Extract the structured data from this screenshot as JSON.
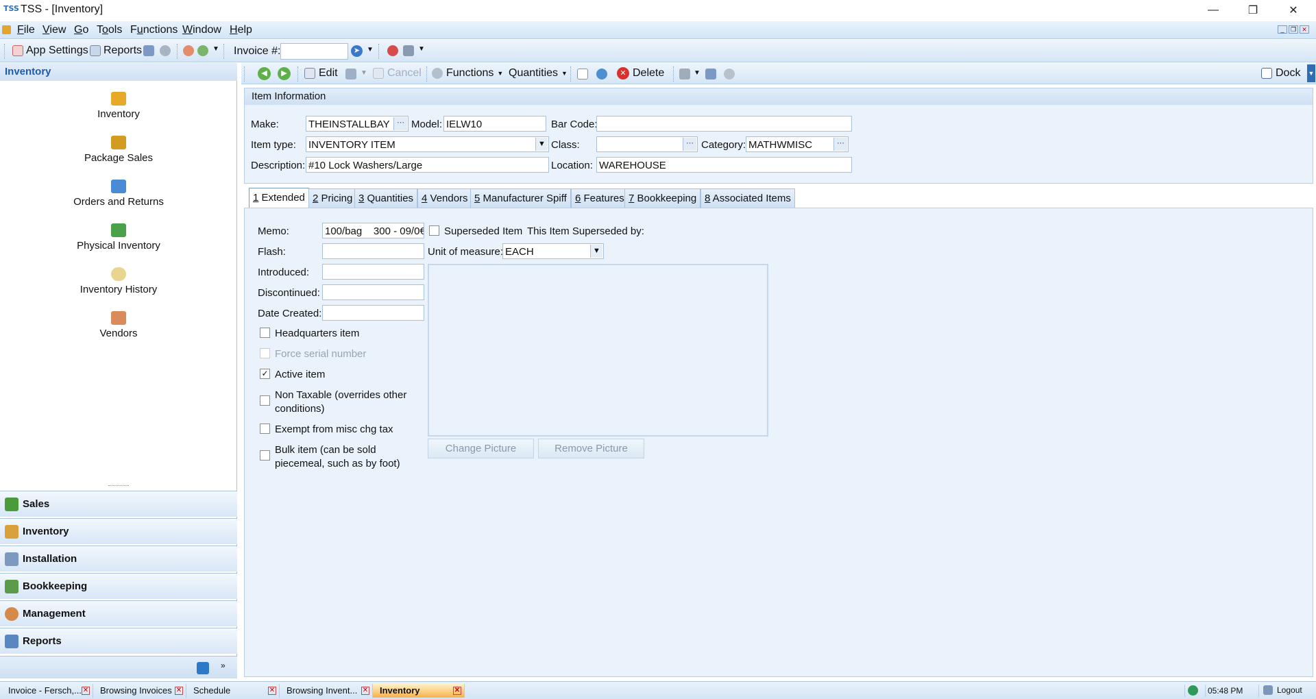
{
  "window": {
    "app_icon_text": "TSS",
    "title": "TSS - [Inventory]"
  },
  "menu": [
    {
      "pre": "",
      "u": "F",
      "post": "ile"
    },
    {
      "pre": "",
      "u": "V",
      "post": "iew"
    },
    {
      "pre": "",
      "u": "G",
      "post": "o"
    },
    {
      "pre": "T",
      "u": "o",
      "post": "ols"
    },
    {
      "pre": "F",
      "u": "u",
      "post": "nctions"
    },
    {
      "pre": "",
      "u": "W",
      "post": "indow"
    },
    {
      "pre": "",
      "u": "H",
      "post": "elp"
    }
  ],
  "toolbar1": {
    "app_settings": "App Settings",
    "reports": "Reports",
    "invoice_label": "Invoice #:",
    "invoice_value": ""
  },
  "leftpanel": {
    "header": "Inventory",
    "items": [
      "Inventory",
      "Package Sales",
      "Orders and Returns",
      "Physical Inventory",
      "Inventory History",
      "Vendors"
    ],
    "sections": [
      "Sales",
      "Inventory",
      "Installation",
      "Bookkeeping",
      "Management",
      "Reports"
    ]
  },
  "toolbar2": {
    "edit": "Edit",
    "cancel": "Cancel",
    "functions": "Functions",
    "quantities": "Quantities",
    "delete": "Delete",
    "dock": "Dock"
  },
  "iteminfo": {
    "header": "Item Information",
    "make_label": "Make:",
    "make": "THEINSTALLBAY",
    "model_label": "Model:",
    "model": "IELW10",
    "barcode_label": "Bar Code:",
    "barcode": "",
    "itemtype_label": "Item type:",
    "itemtype": "INVENTORY ITEM",
    "class_label": "Class:",
    "class": "",
    "category_label": "Category:",
    "category": "MATHWMISC",
    "description_label": "Description:",
    "description": "#10 Lock Washers/Large",
    "location_label": "Location:",
    "location": "WAREHOUSE"
  },
  "tabs": [
    {
      "num": "1",
      "label": " Extended"
    },
    {
      "num": "2",
      "label": " Pricing"
    },
    {
      "num": "3",
      "label": " Quantities"
    },
    {
      "num": "4",
      "label": " Vendors"
    },
    {
      "num": "5",
      "label": " Manufacturer Spiff"
    },
    {
      "num": "6",
      "label": " Features"
    },
    {
      "num": "7",
      "label": " Bookkeeping"
    },
    {
      "num": "8",
      "label": " Associated Items"
    }
  ],
  "extended": {
    "memo_label": "Memo:",
    "memo": "100/bag    300 - 09/0€",
    "flash_label": "Flash:",
    "flash": "",
    "introduced_label": "Introduced:",
    "introduced": "",
    "discontinued_label": "Discontinued:",
    "discontinued": "",
    "datecreated_label": "Date Created:",
    "datecreated": "",
    "superseded_label": "Superseded Item",
    "superseded_by_label": "This Item Superseded by:",
    "uom_label": "Unit of measure:",
    "uom": "EACH",
    "hq": "Headquarters item",
    "force_serial": "Force serial number",
    "active": "Active item",
    "nontax1": "Non Taxable (overrides other",
    "nontax2": "conditions)",
    "exempt": "Exempt from misc chg tax",
    "bulk1": "Bulk item (can be sold",
    "bulk2": "piecemeal, such as by foot)",
    "change_picture": "Change Picture",
    "remove_picture": "Remove Picture"
  },
  "taskbar": {
    "tasks": [
      "Invoice - Fersch,...",
      "Browsing Invoices",
      "Schedule",
      "Browsing Invent...",
      "Inventory"
    ],
    "time": "05:48 PM",
    "logout": "Logout"
  }
}
